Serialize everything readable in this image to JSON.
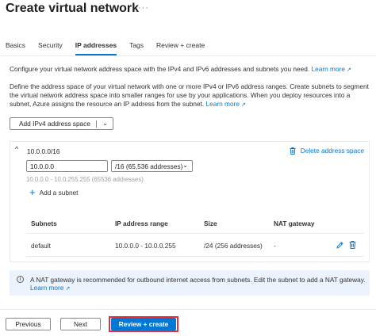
{
  "page": {
    "title": "Create virtual network",
    "more": "···"
  },
  "tabs": [
    {
      "label": "Basics",
      "active": false
    },
    {
      "label": "Security",
      "active": false
    },
    {
      "label": "IP addresses",
      "active": true
    },
    {
      "label": "Tags",
      "active": false
    },
    {
      "label": "Review + create",
      "active": false
    }
  ],
  "intro": {
    "text": "Configure your virtual network address space with the IPv4 and IPv6 addresses and subnets you need.",
    "link": "Learn more"
  },
  "define": {
    "text": "Define the address space of your virtual network with one or more IPv4 or IPv6 address ranges. Create subnets to segment the virtual network address space into smaller ranges for use by your applications. When you deploy resources into a subnet, Azure assigns the resource an IP address from the subnet.",
    "link": "Learn more"
  },
  "add_space_button": {
    "label": "Add IPv4 address space"
  },
  "address_space": {
    "title": "10.0.0.0/16",
    "delete_label": "Delete address space",
    "address_value": "10.0.0.0",
    "prefix_value": "/16 (65,536 addresses)",
    "range_hint": "10.0.0.0 - 10.0.255.255 (65536 addresses)",
    "add_subnet_label": "Add a subnet"
  },
  "subnet_table": {
    "headers": {
      "subnets": "Subnets",
      "range": "IP address range",
      "size": "Size",
      "nat": "NAT gateway"
    },
    "rows": [
      {
        "name": "default",
        "range": "10.0.0.0 - 10.0.0.255",
        "size": "/24 (256 addresses)",
        "nat": "-"
      }
    ]
  },
  "info": {
    "text": "A NAT gateway is recommended for outbound internet access from subnets. Edit the subnet to add a NAT gateway.",
    "link": "Learn more"
  },
  "footer": {
    "previous": "Previous",
    "next": "Next",
    "review": "Review + create"
  },
  "colors": {
    "accent": "#0078d4",
    "highlight": "#e3303c",
    "info_bg": "#ebf3fc"
  },
  "icons": [
    "ellipsis-icon",
    "external-link-icon",
    "chevron-down-icon",
    "chevron-up-icon",
    "trash-icon",
    "plus-icon",
    "edit-icon",
    "info-icon"
  ]
}
